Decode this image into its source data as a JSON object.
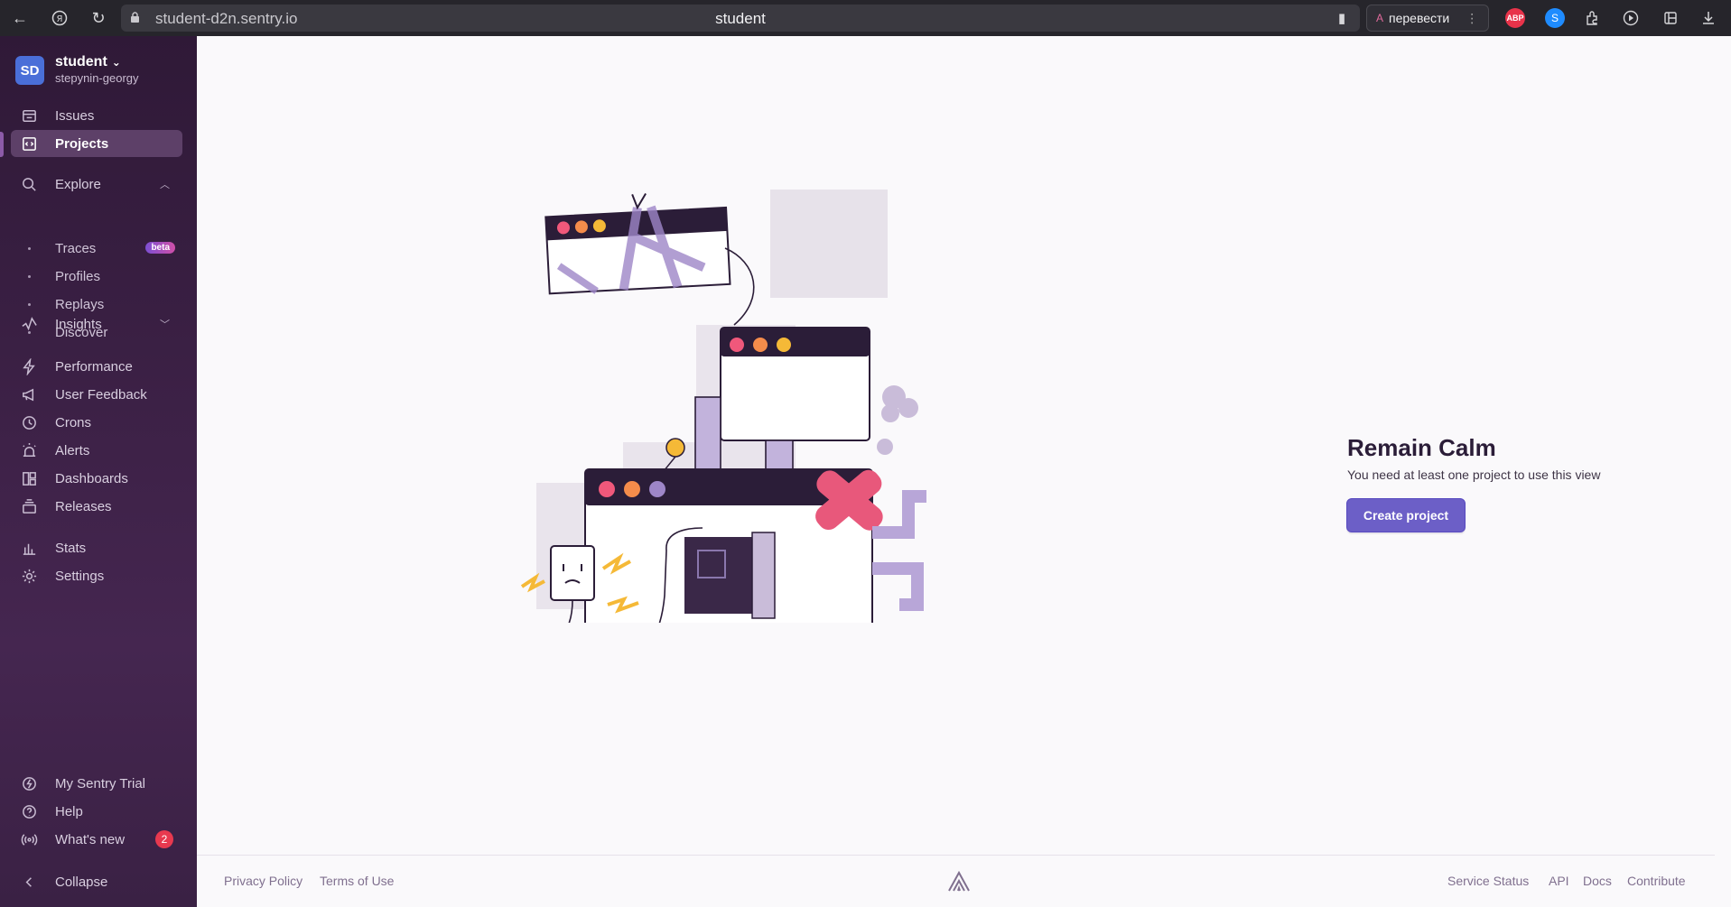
{
  "browser": {
    "url": "student-d2n.sentry.io",
    "tab_title": "student",
    "translate_label": "перевести",
    "abp_label": "ABP"
  },
  "org": {
    "avatar": "SD",
    "name": "student",
    "user": "stepynin-georgy"
  },
  "nav": {
    "issues": "Issues",
    "projects": "Projects",
    "explore": "Explore",
    "traces": "Traces",
    "traces_badge": "beta",
    "profiles": "Profiles",
    "replays": "Replays",
    "discover": "Discover",
    "insights": "Insights",
    "performance": "Performance",
    "user_feedback": "User Feedback",
    "crons": "Crons",
    "alerts": "Alerts",
    "dashboards": "Dashboards",
    "releases": "Releases",
    "stats": "Stats",
    "settings": "Settings",
    "trial": "My Sentry Trial",
    "help": "Help",
    "whats_new": "What's new",
    "whats_new_count": "2",
    "collapse": "Collapse"
  },
  "empty_state": {
    "title": "Remain Calm",
    "description": "You need at least one project to use this view",
    "button": "Create project"
  },
  "footer": {
    "privacy": "Privacy Policy",
    "terms": "Terms of Use",
    "status": "Service Status",
    "api": "API",
    "docs": "Docs",
    "contribute": "Contribute"
  },
  "colors": {
    "accent": "#6c5fc7",
    "sidebar": "#2f1937",
    "badge": "#e8394f"
  }
}
